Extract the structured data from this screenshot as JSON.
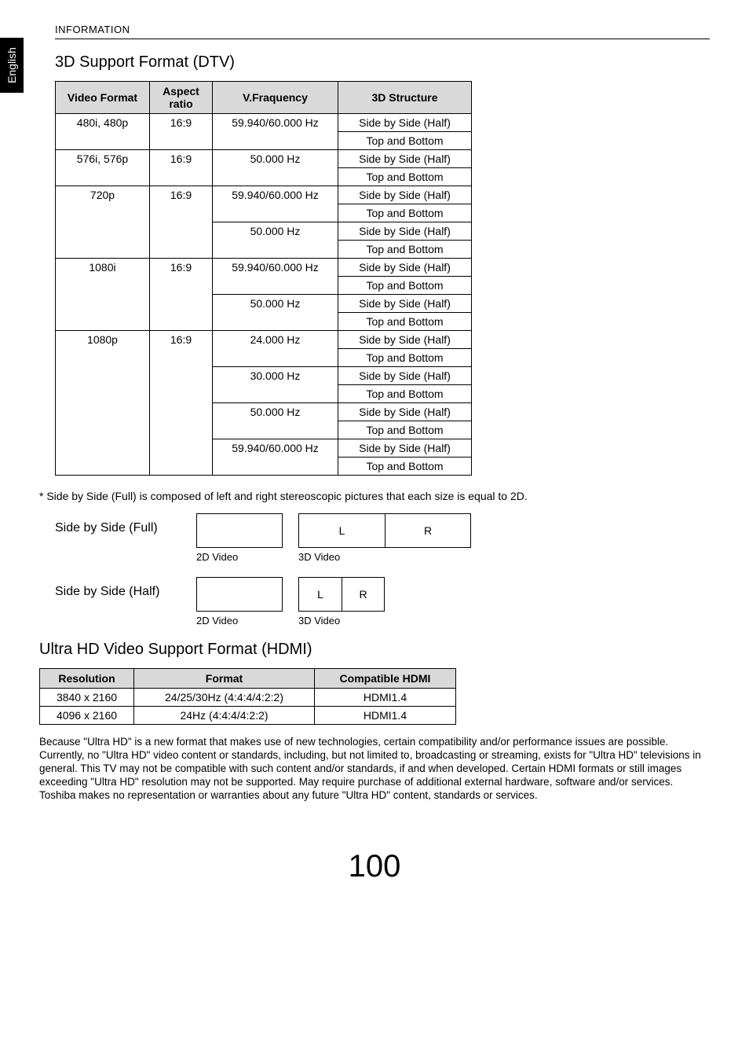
{
  "header": "INFORMATION",
  "langTab": "English",
  "section3d": {
    "title": "3D Support Format (DTV)",
    "headers": {
      "h1": "Video Format",
      "h2": "Aspect ratio",
      "h3": "V.Fraquency",
      "h4": "3D Structure"
    },
    "rows": [
      {
        "vf": "480i, 480p",
        "ar": "16:9",
        "freq": "59.940/60.000 Hz",
        "s": "Side by Side (Half)"
      },
      {
        "vf": "",
        "ar": "",
        "freq": "",
        "s": "Top and Bottom"
      },
      {
        "vf": "576i, 576p",
        "ar": "16:9",
        "freq": "50.000 Hz",
        "s": "Side by Side (Half)"
      },
      {
        "vf": "",
        "ar": "",
        "freq": "",
        "s": "Top and Bottom"
      },
      {
        "vf": "720p",
        "ar": "16:9",
        "freq": "59.940/60.000 Hz",
        "s": "Side by Side (Half)"
      },
      {
        "vf": "",
        "ar": "",
        "freq": "",
        "s": "Top and Bottom"
      },
      {
        "vf": "",
        "ar": "",
        "freq": "50.000 Hz",
        "s": "Side by Side (Half)"
      },
      {
        "vf": "",
        "ar": "",
        "freq": "",
        "s": "Top and Bottom"
      },
      {
        "vf": "1080i",
        "ar": "16:9",
        "freq": "59.940/60.000 Hz",
        "s": "Side by Side (Half)"
      },
      {
        "vf": "",
        "ar": "",
        "freq": "",
        "s": "Top and Bottom"
      },
      {
        "vf": "",
        "ar": "",
        "freq": "50.000 Hz",
        "s": "Side by Side (Half)"
      },
      {
        "vf": "",
        "ar": "",
        "freq": "",
        "s": "Top and Bottom"
      },
      {
        "vf": "1080p",
        "ar": "16:9",
        "freq": "24.000 Hz",
        "s": "Side by Side (Half)"
      },
      {
        "vf": "",
        "ar": "",
        "freq": "",
        "s": "Top and Bottom"
      },
      {
        "vf": "",
        "ar": "",
        "freq": "30.000 Hz",
        "s": "Side by Side (Half)"
      },
      {
        "vf": "",
        "ar": "",
        "freq": "",
        "s": "Top and Bottom"
      },
      {
        "vf": "",
        "ar": "",
        "freq": "50.000 Hz",
        "s": "Side by Side (Half)"
      },
      {
        "vf": "",
        "ar": "",
        "freq": "",
        "s": "Top and Bottom"
      },
      {
        "vf": "",
        "ar": "",
        "freq": "59.940/60.000 Hz",
        "s": "Side by Side (Half)"
      },
      {
        "vf": "",
        "ar": "",
        "freq": "",
        "s": "Top and Bottom"
      }
    ]
  },
  "footnote": "* Side by Side (Full) is composed of left and right stereoscopic pictures that each size is equal to 2D.",
  "diagram": {
    "fullLabel": "Side by Side (Full)",
    "halfLabel": "Side by Side (Half)",
    "label2d": "2D Video",
    "label3d": "3D Video",
    "L": "L",
    "R": "R"
  },
  "sectionHdmi": {
    "title": "Ultra HD Video Support Format (HDMI)",
    "headers": {
      "h1": "Resolution",
      "h2": "Format",
      "h3": "Compatible HDMI"
    },
    "rows": [
      {
        "res": "3840 x 2160",
        "fmt": "24/25/30Hz (4:4:4/4:2:2)",
        "hdmi": "HDMI1.4"
      },
      {
        "res": "4096 x 2160",
        "fmt": "24Hz (4:4:4/4:2:2)",
        "hdmi": "HDMI1.4"
      }
    ]
  },
  "disclaimer": "Because \"Ultra HD\" is a new format that makes use of new technologies, certain compatibility and/or performance issues are possible. Currently, no \"Ultra HD\" video content or standards, including, but not limited to, broadcasting or streaming, exists for \"Ultra HD\" televisions in general. This TV may not be compatible with such content and/or standards, if and when developed. Certain HDMI formats or still images exceeding \"Ultra HD\" resolution may not be supported. May require purchase of additional external hardware, software and/or services. Toshiba makes no representation or warranties about any future \"Ultra HD\" content, standards or services.",
  "pageNumber": "100"
}
